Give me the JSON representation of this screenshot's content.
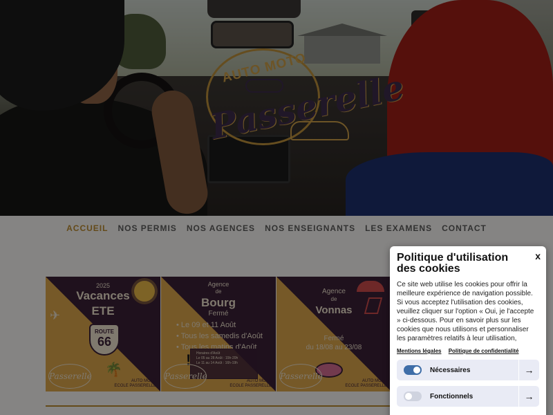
{
  "hero": {
    "logo_top": "AUTO MOTO",
    "logo_script": "Passerelle"
  },
  "nav": {
    "items": [
      {
        "label": "ACCUEIL",
        "active": true
      },
      {
        "label": "NOS PERMIS",
        "active": false
      },
      {
        "label": "NOS AGENCES",
        "active": false
      },
      {
        "label": "NOS ENSEIGNANTS",
        "active": false
      },
      {
        "label": "LES EXAMENS",
        "active": false
      },
      {
        "label": "CONTACT",
        "active": false
      }
    ]
  },
  "cards": {
    "c1": {
      "year": "2025",
      "title": "Vacances",
      "subtitle": "ETE",
      "shield_top": "ROUTE",
      "shield_num": "66",
      "logo": "Passerelle",
      "footer": "AUTO MOTO\nECOLE PASSERELLE"
    },
    "c2": {
      "pre": "Agence",
      "de": "de",
      "city": "Bourg",
      "status": "Fermé",
      "lines": [
        "Le 09 et 11 Août",
        "Tous les samedis d'Août",
        "Tous les matins d'Août"
      ],
      "notice": "Horaires d'Août\nLe 05 au 28 Août : 15h-20h\nLe 11 au 14 Août : 16h-19h",
      "logo": "Passerelle",
      "footer": "AUTO MOTO\nECOLE PASSERELLE"
    },
    "c3": {
      "pre": "Agence",
      "de": "de",
      "city": "Vonnas",
      "status": "Fermé",
      "dates": "du 18/08 au 23/08",
      "logo": "Passerelle",
      "footer": "AUTO MOTO\nECOLE PASSERELLE"
    }
  },
  "cookie": {
    "title": "Politique d'utilisation des cookies",
    "close": "x",
    "body": "Ce site web utilise les cookies pour offrir la meilleure expérience de navigation possible. Si vous acceptez l'utilisation des cookies, veuillez cliquer sur l'option « Oui, je l'accepte » ci-dessous. Pour en savoir plus sur les cookies que nous utilisons et personnaliser les paramètres relatifs à leur utilisation, veuillez",
    "link_legal": "Mentions légales",
    "link_privacy": "Politique de confidentialité",
    "toggles": [
      {
        "label": "Nécessaires",
        "on": true
      },
      {
        "label": "Fonctionnels",
        "on": false
      }
    ],
    "arrow": "→"
  },
  "colors": {
    "accent": "#b7882f",
    "card_dark": "#3a1f36",
    "card_gold": "#d8a34a",
    "toggle_on": "#3f6ea8"
  }
}
